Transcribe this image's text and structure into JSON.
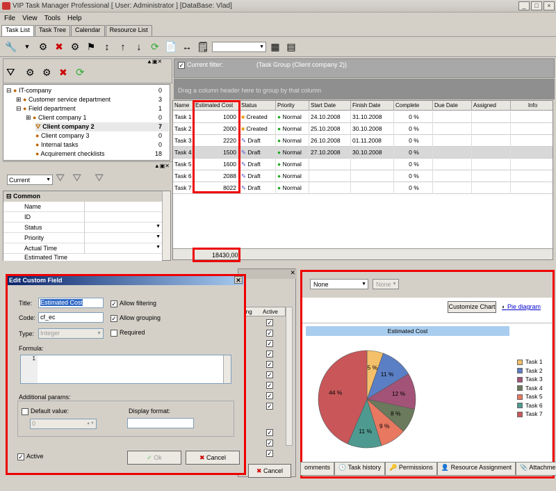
{
  "window": {
    "title": "VIP Task Manager Professional [ User: Administrator ] [DataBase: Vlad]"
  },
  "menu": [
    "File",
    "View",
    "Tools",
    "Help"
  ],
  "tabs": [
    "Task List",
    "Task Tree",
    "Calendar",
    "Resource List"
  ],
  "filter": {
    "label": "Current filter:",
    "value": "(Task Group  (Client company 2))"
  },
  "group_hint": "Drag a column header here to group by that column",
  "tree": [
    {
      "label": "IT-company",
      "count": "0"
    },
    {
      "label": "Customer service department",
      "count": "3"
    },
    {
      "label": "Field department",
      "count": "1"
    },
    {
      "label": "Client company 1",
      "count": "0"
    },
    {
      "label": "Client company 2",
      "count": "7"
    },
    {
      "label": "Client company 3",
      "count": "0"
    },
    {
      "label": "Internal tasks",
      "count": "0"
    },
    {
      "label": "Acquirement checklists",
      "count": "18"
    }
  ],
  "props": {
    "combo": "Current",
    "section": "Common",
    "rows": [
      "Name",
      "ID",
      "Status",
      "Priority",
      "Actual Time",
      "Estimated Time"
    ]
  },
  "grid": {
    "columns": [
      "Name",
      "Estimated Cost",
      "Status",
      "Priority",
      "Start Date",
      "Finish Date",
      "Complete",
      "Due Date",
      "Assigned",
      "Info"
    ],
    "rows": [
      {
        "name": "Task 1",
        "cost": "1000",
        "status": "Created",
        "priority": "Normal",
        "start": "24.10.2008",
        "finish": "31.10.2008",
        "complete": "0 %"
      },
      {
        "name": "Task 2",
        "cost": "2000",
        "status": "Created",
        "priority": "Normal",
        "start": "25.10.2008",
        "finish": "30.10.2008",
        "complete": "0 %"
      },
      {
        "name": "Task 3",
        "cost": "2220",
        "status": "Draft",
        "priority": "Normal",
        "start": "26.10.2008",
        "finish": "01.11.2008",
        "complete": "0 %"
      },
      {
        "name": "Task 4",
        "cost": "1500",
        "status": "Draft",
        "priority": "Normal",
        "start": "27.10.2008",
        "finish": "30.10.2008",
        "complete": "0 %"
      },
      {
        "name": "Task 5",
        "cost": "1600",
        "status": "Draft",
        "priority": "Normal",
        "start": "",
        "finish": "",
        "complete": "0 %"
      },
      {
        "name": "Task 6",
        "cost": "2088",
        "status": "Draft",
        "priority": "Normal",
        "start": "",
        "finish": "",
        "complete": "0 %"
      },
      {
        "name": "Task 7",
        "cost": "8022",
        "status": "Draft",
        "priority": "Normal",
        "start": "",
        "finish": "",
        "complete": "0 %"
      }
    ],
    "total": "18430,00"
  },
  "dialog": {
    "title": "Edit Custom Field",
    "title_label": "Title:",
    "title_value": "Estimated Cost",
    "code_label": "Code:",
    "code_value": "cf_ec",
    "type_label": "Type:",
    "type_value": "Integer",
    "allow_filtering": "Allow filtering",
    "allow_grouping": "Allow grouping",
    "required": "Required",
    "formula_label": "Formula:",
    "formula_line": "1",
    "additional": "Additional params:",
    "default_value": "Default value:",
    "default_num": "0",
    "display_format": "Display format:",
    "active": "Active",
    "ok": "Ok",
    "cancel": "Cancel"
  },
  "bg_dialog": {
    "col_ing": "ing",
    "col_active": "Active",
    "cancel": "Cancel"
  },
  "chart_panel": {
    "combo1": "None",
    "combo2": "None",
    "customize": "Customize Chart",
    "pie_link": "Pie diagram"
  },
  "chart_data": {
    "type": "pie",
    "title": "Estimated Cost",
    "categories": [
      "Task 1",
      "Task 2",
      "Task 3",
      "Task 4",
      "Task 5",
      "Task 6",
      "Task 7"
    ],
    "values": [
      1000,
      2000,
      2220,
      1500,
      1600,
      2088,
      8022
    ],
    "slice_labels": [
      "5 %",
      "11 %",
      "12 %",
      "8 %",
      "9 %",
      "11 %",
      "44 %"
    ],
    "colors": [
      "#f4c06a",
      "#5b7fc4",
      "#a25377",
      "#6b7a5c",
      "#e87860",
      "#4f9a90",
      "#c9575a"
    ],
    "legend": "right"
  },
  "bottom_tabs": [
    "omments",
    "Task history",
    "Permissions",
    "Resource Assignment",
    "Attachments"
  ]
}
